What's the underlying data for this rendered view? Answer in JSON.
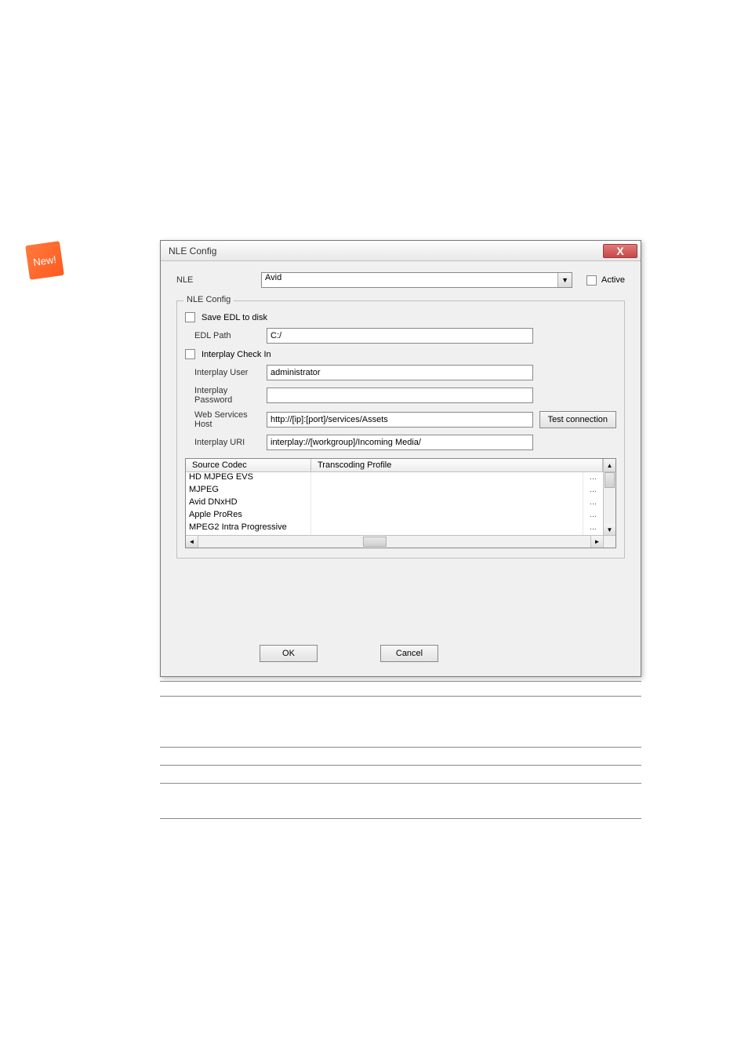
{
  "badge": {
    "text": "New!"
  },
  "dialog": {
    "title": "NLE Config",
    "close_label": "X",
    "nle_label": "NLE",
    "nle_value": "Avid",
    "active_label": "Active",
    "groupbox_title": "NLE Config",
    "save_edl_label": "Save EDL to disk",
    "edl_path_label": "EDL Path",
    "edl_path_value": "C:/",
    "interplay_checkin_label": "Interplay Check In",
    "interplay_user_label": "Interplay User",
    "interplay_user_value": "administrator",
    "interplay_password_label": "Interplay Password",
    "interplay_password_value": "",
    "web_services_host_label": "Web Services Host",
    "web_services_host_value": "http://[ip]:[port]/services/Assets",
    "test_connection_label": "Test connection",
    "interplay_uri_label": "Interplay URI",
    "interplay_uri_value": "interplay://[workgroup]/Incoming Media/",
    "codec_table": {
      "header_source": "Source Codec",
      "header_profile": "Transcoding Profile",
      "rows": [
        {
          "codec": "HD MJPEG EVS",
          "browse": "..."
        },
        {
          "codec": "MJPEG",
          "browse": "..."
        },
        {
          "codec": "Avid DNxHD",
          "browse": "..."
        },
        {
          "codec": "Apple ProRes",
          "browse": "..."
        },
        {
          "codec": "MPEG2 Intra Progressive",
          "browse": "..."
        }
      ]
    },
    "ok_label": "OK",
    "cancel_label": "Cancel"
  }
}
